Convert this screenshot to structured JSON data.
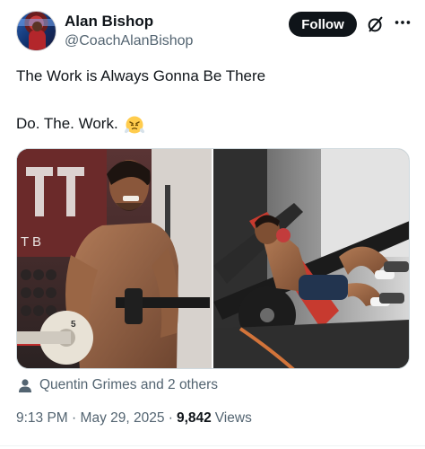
{
  "author": {
    "name": "Alan Bishop",
    "handle": "@CoachAlanBishop"
  },
  "actions": {
    "follow_label": "Follow",
    "grok_icon": "grok-icon",
    "more_icon": "more-horizontal-icon"
  },
  "tweet": {
    "line1": "The Work is Always Gonna Be There",
    "line2": "Do. The. Work.",
    "emoji": "face-with-steam-from-nose"
  },
  "media": {
    "left_photo_sign": "T  B",
    "plate_label": "5",
    "count": 2
  },
  "tagged": {
    "text": "Quentin Grimes and 2 others",
    "icon": "person-icon"
  },
  "meta": {
    "time": "9:13 PM",
    "separator": "·",
    "date": "May 29, 2025",
    "views_count": "9,842",
    "views_label": "Views"
  },
  "colors": {
    "text_primary": "#0f1419",
    "text_secondary": "#536471",
    "follow_bg": "#0f1419"
  }
}
